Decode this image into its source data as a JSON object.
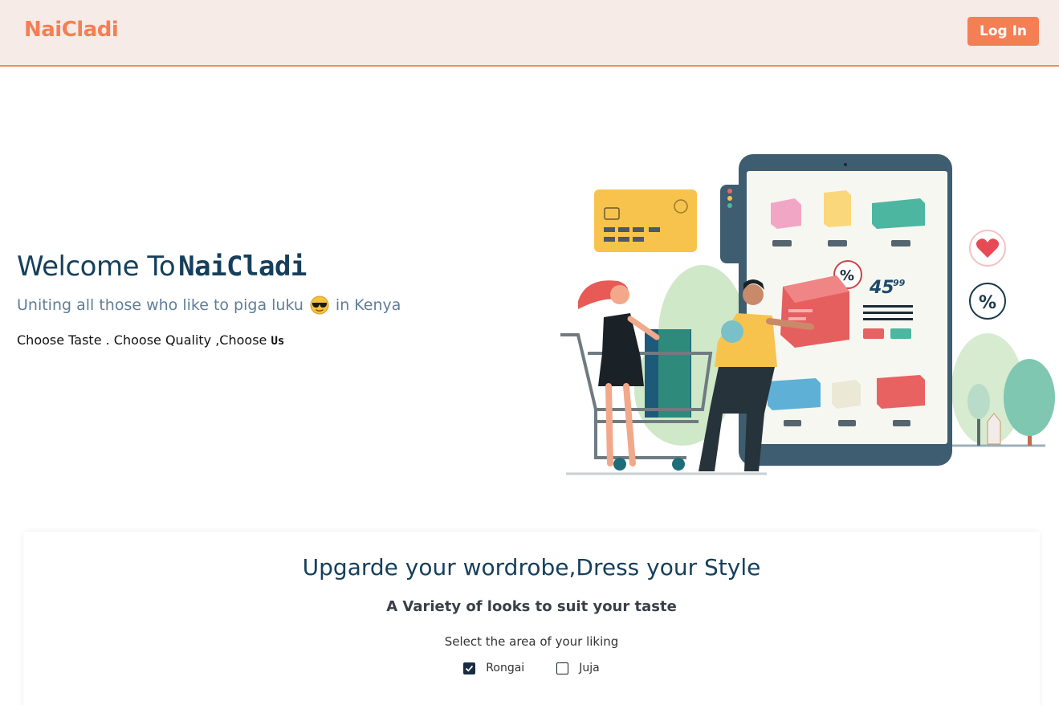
{
  "nav": {
    "brand": "NaiCladi",
    "login_label": "Log In"
  },
  "hero": {
    "welcome_prefix": "Welcome To",
    "welcome_brand": "NaiCladi",
    "tagline_before": "Uniting all those who like to piga luku",
    "tagline_emoji": "smiling-face-with-sunglasses",
    "tagline_after": "in Kenya",
    "choose_prefix": "Choose Taste . Choose Quality ,Choose",
    "choose_us": "Us",
    "illustration": {
      "price_whole": "45",
      "price_cents": "99",
      "percent_badge": "%"
    }
  },
  "section": {
    "title": "Upgarde your wordrobe,Dress your Style",
    "subtitle": "A Variety of looks to suit your taste",
    "prompt": "Select the area of your liking",
    "options": [
      {
        "label": "Rongai",
        "checked": true
      },
      {
        "label": "Juja",
        "checked": false
      }
    ]
  },
  "colors": {
    "accent": "#f47f55",
    "navy": "#163f5c",
    "nav_bg": "#f7ebe7"
  }
}
